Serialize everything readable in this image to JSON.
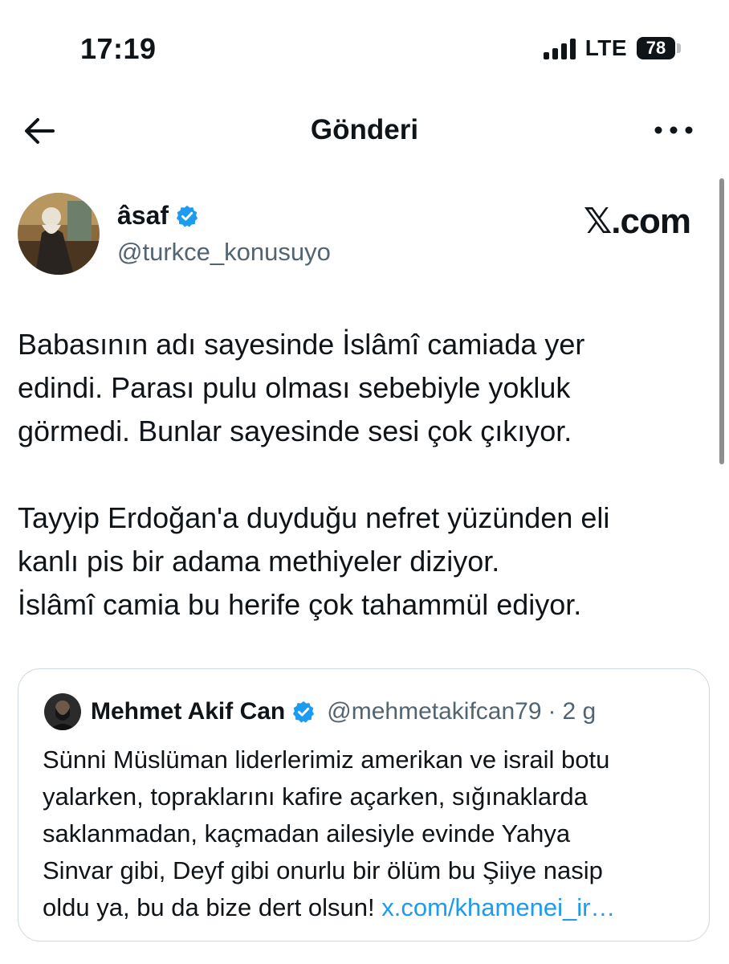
{
  "status_bar": {
    "time": "17:19",
    "network": "LTE",
    "battery": "78"
  },
  "header": {
    "title": "Gönderi",
    "back_icon": "arrow-left-icon",
    "more_icon": "ellipsis-icon"
  },
  "author": {
    "name": "âsaf",
    "handle": "@turkce_konusuyo",
    "verified": true
  },
  "brand": {
    "symbol": "𝕏",
    "suffix": ".com"
  },
  "tweet": {
    "lines_p1": [
      "Babasının adı sayesinde İslâmî camiada yer",
      "edindi. Parası pulu olması sebebiyle yokluk",
      "görmedi. Bunlar sayesinde sesi çok çıkıyor."
    ],
    "lines_p2": [
      "Tayyip Erdoğan'a duyduğu nefret yüzünden eli",
      "kanlı pis bir adama methiyeler diziyor.",
      "İslâmî camia bu herife çok tahammül ediyor."
    ]
  },
  "quote": {
    "name": "Mehmet Akif Can",
    "handle": "@mehmetakifcan79",
    "separator": "·",
    "time": "2 g",
    "verified": true,
    "lines": [
      "Sünni Müslüman liderlerimiz amerikan ve israil botu",
      "yalarken, topraklarını kafire açarken, sığınaklarda",
      "saklanmadan, kaçmadan ailesiyle evinde Yahya",
      "Sinvar gibi, Deyf gibi onurlu bir ölüm bu Şiiye nasip"
    ],
    "last_line_text": "oldu ya, bu da bize dert olsun!",
    "link": "x.com/khamenei_ir…"
  },
  "colors": {
    "text": "#0f1419",
    "secondary": "#536471",
    "link": "#1d9bf0",
    "verified": "#1d9bf0",
    "border": "#cfd9de"
  }
}
